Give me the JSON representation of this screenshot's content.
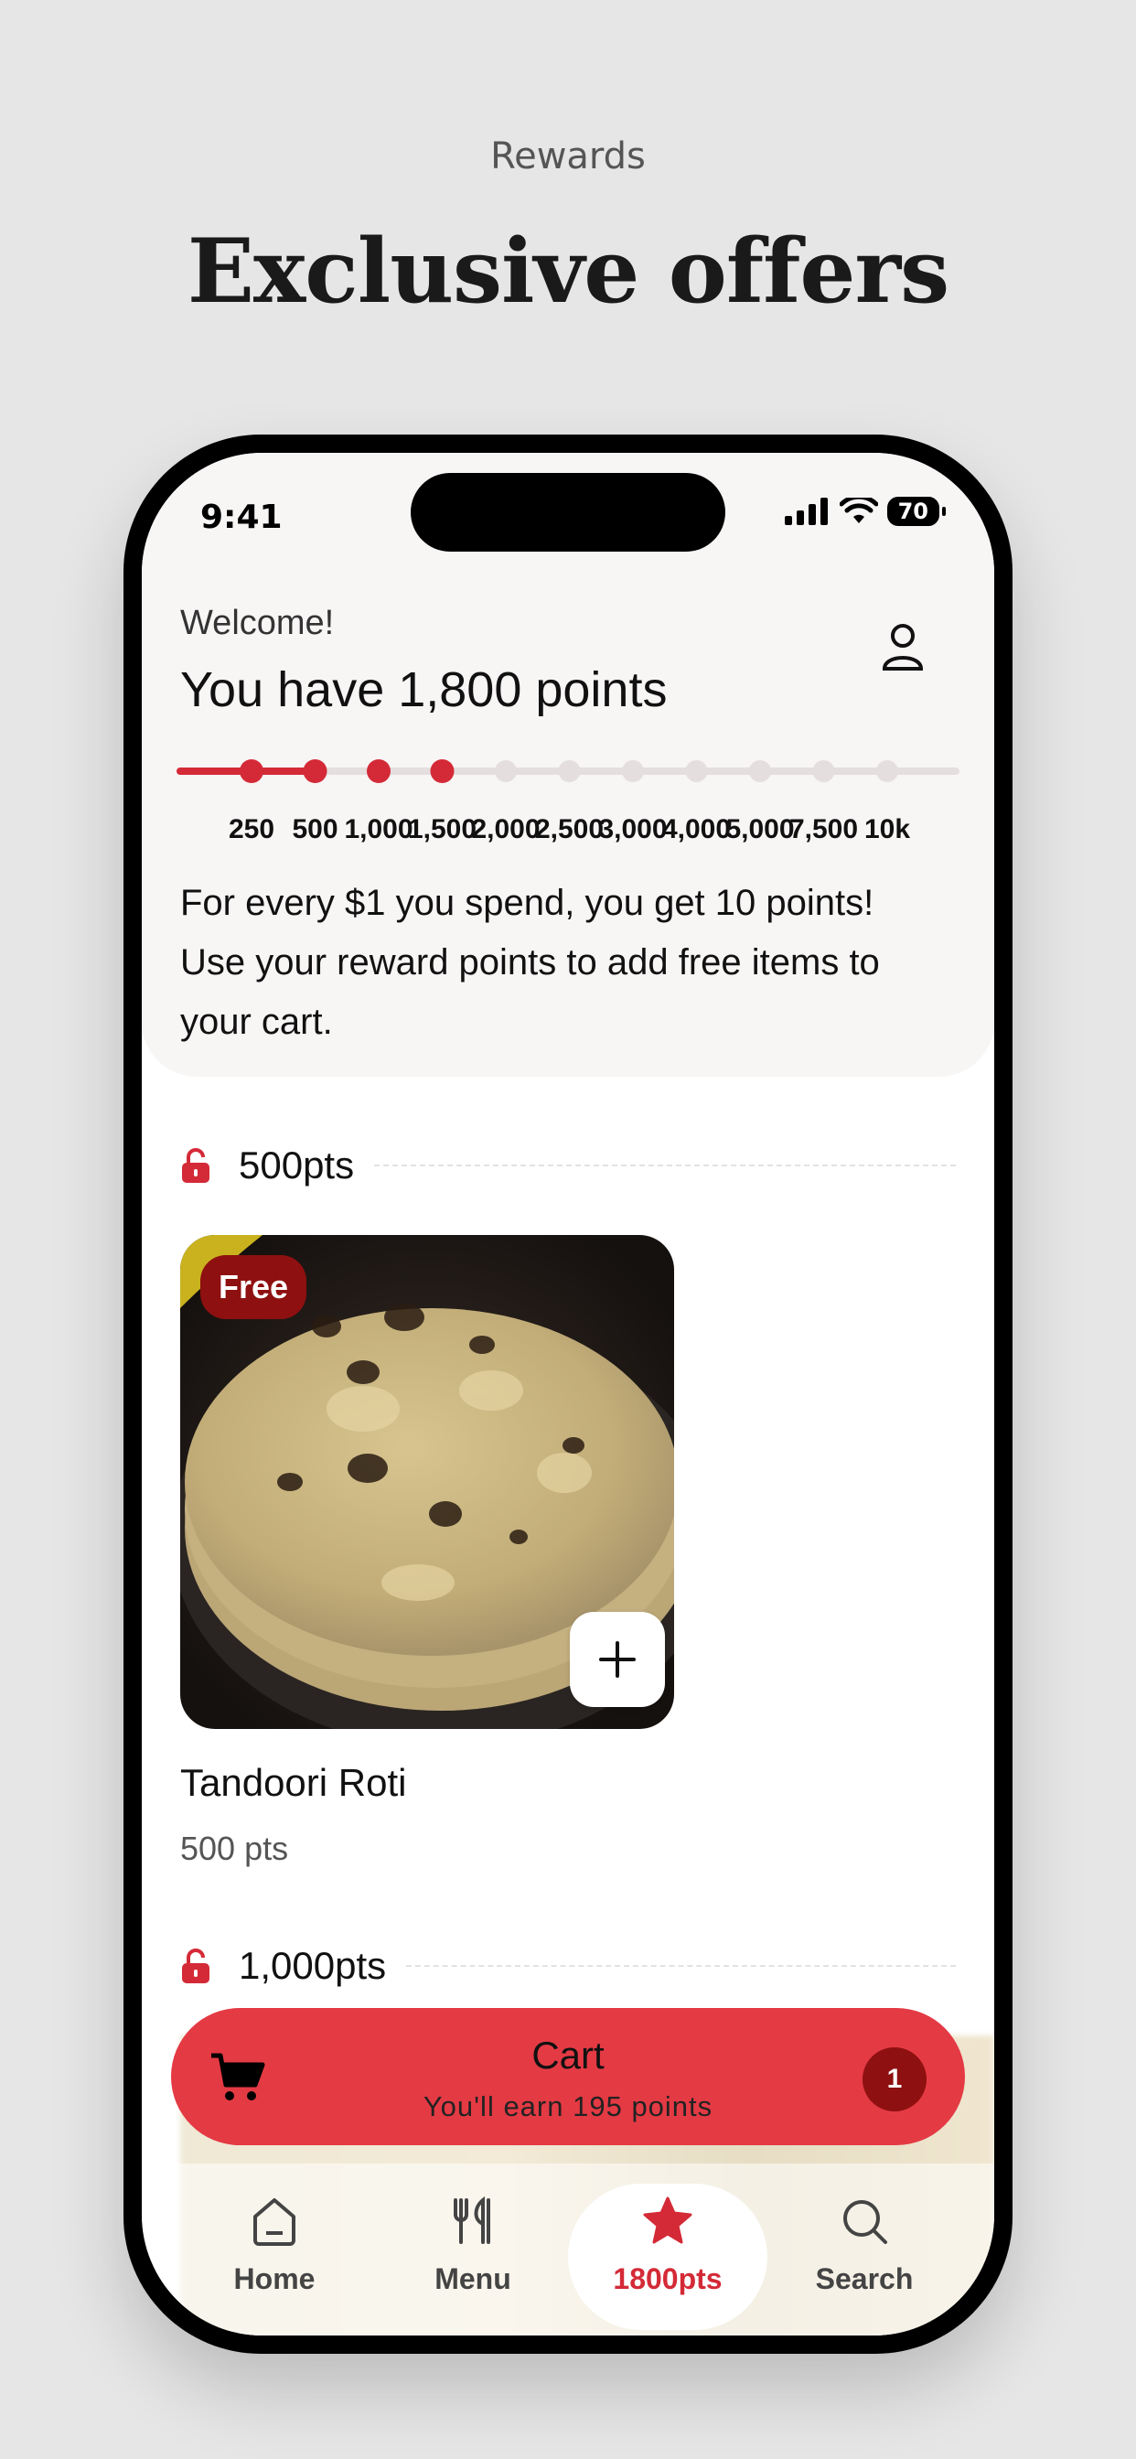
{
  "page": {
    "subtitle": "Rewards",
    "title": "Exclusive offers"
  },
  "status_bar": {
    "time": "9:41",
    "battery": "70"
  },
  "rewards": {
    "welcome": "Welcome!",
    "points_title": "You have 1,800 points",
    "milestones": [
      "250",
      "500",
      "1,000",
      "1,500",
      "2,000",
      "2,500",
      "3,000",
      "4,000",
      "5,000",
      "7,500",
      "10k"
    ],
    "points_current": 1800,
    "reached_count": 4,
    "info_line1": "For every $1 you spend, you get 10 points!",
    "info_line2": "Use your reward points to add free items to",
    "info_line3": "your cart."
  },
  "sections": [
    {
      "label": "500pts"
    },
    {
      "label": "1,000pts"
    }
  ],
  "item": {
    "badge": "Free",
    "name": "Tandoori Roti",
    "points": "500 pts"
  },
  "cart": {
    "title": "Cart",
    "subtitle": "You'll earn 195 points",
    "count": "1"
  },
  "tabs": [
    {
      "label": "Home",
      "icon": "home-icon"
    },
    {
      "label": "Menu",
      "icon": "fork-knife-icon"
    },
    {
      "label": "1800pts",
      "icon": "star-icon",
      "active": true
    },
    {
      "label": "Search",
      "icon": "search-icon"
    }
  ],
  "colors": {
    "accent": "#d42a37",
    "cart": "#e43a44",
    "badge": "#8e1010",
    "background": "#e6e6e6"
  }
}
